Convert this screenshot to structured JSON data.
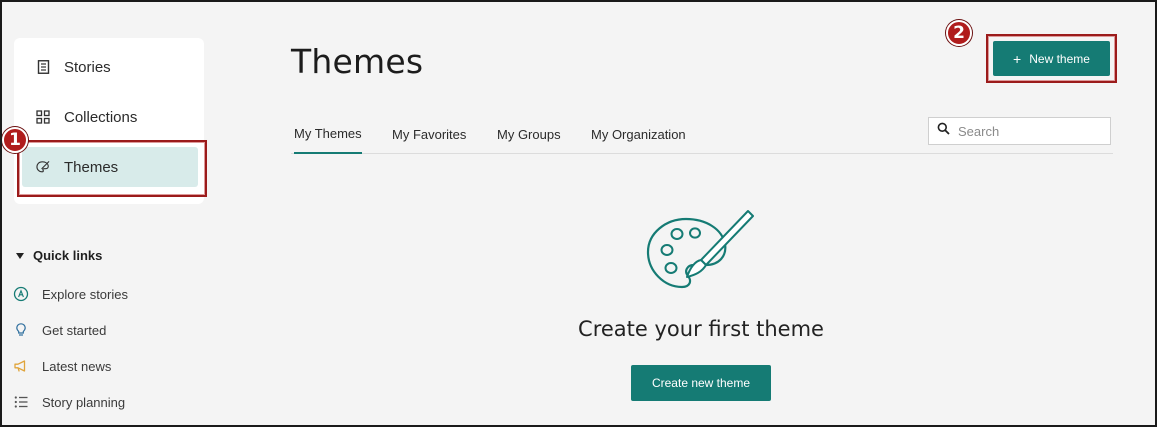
{
  "sidebar": {
    "nav": [
      {
        "label": "Stories",
        "icon": "document-icon"
      },
      {
        "label": "Collections",
        "icon": "grid-icon"
      },
      {
        "label": "Themes",
        "icon": "palette-icon",
        "active": true
      }
    ],
    "quick_links_label": "Quick links",
    "quick_links": [
      {
        "label": "Explore stories",
        "icon": "compass-icon"
      },
      {
        "label": "Get started",
        "icon": "lightbulb-icon"
      },
      {
        "label": "Latest news",
        "icon": "megaphone-icon"
      },
      {
        "label": "Story planning",
        "icon": "checklist-icon"
      }
    ]
  },
  "main": {
    "title": "Themes",
    "new_button": {
      "plus": "+",
      "label": "New theme"
    },
    "tabs": [
      {
        "label": "My Themes",
        "active": true
      },
      {
        "label": "My Favorites"
      },
      {
        "label": "My Groups"
      },
      {
        "label": "My Organization"
      }
    ],
    "search": {
      "placeholder": "Search"
    },
    "empty_state": {
      "title": "Create your first theme",
      "button_label": "Create new theme"
    }
  },
  "annotations": {
    "one": "1",
    "two": "2"
  },
  "colors": {
    "accent": "#157b74",
    "active_nav_bg": "#d8ebea",
    "annotation": "#9b1b1b",
    "quick_link_news": "#e0a43a"
  }
}
